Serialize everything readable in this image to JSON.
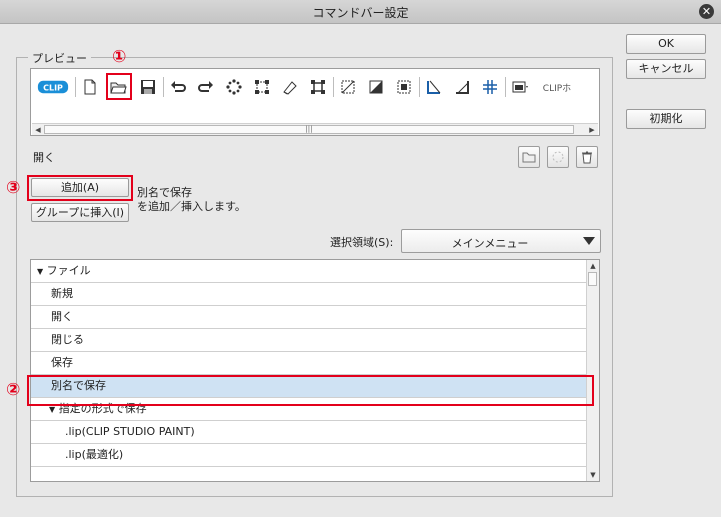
{
  "window": {
    "title": "コマンドバー設定"
  },
  "buttons": {
    "ok": "OK",
    "cancel": "キャンセル",
    "reset": "初期化",
    "add": "追加(A)",
    "insert_group": "グループに挿入(I)"
  },
  "preview": {
    "legend": "プレビュー",
    "toolbar_icons": [
      "clip-logo-icon",
      "new-file-icon",
      "open-folder-icon",
      "save-icon",
      "undo-icon",
      "redo-icon",
      "delete-icon",
      "transform-icon",
      "clear-icon",
      "rotate-icon",
      "select-icon",
      "invert-icon",
      "grid-icon",
      "ruler-icon",
      "snap-icon",
      "layer-icon",
      "dropdown-icon",
      "clip-text-icon"
    ],
    "selected_command": "開く",
    "clip_text": "CLIPホ"
  },
  "description": {
    "line1": "別名で保存",
    "line2": "を追加／挿入します。"
  },
  "select_area": {
    "label": "選択領域(S):",
    "value": "メインメニュー"
  },
  "tree": [
    {
      "label": "ファイル",
      "expandable": true
    },
    {
      "label": "新規"
    },
    {
      "label": "開く"
    },
    {
      "label": "閉じる"
    },
    {
      "label": "保存"
    },
    {
      "label": "別名で保存",
      "selected": true
    },
    {
      "label": "指定の形式で保存",
      "expandable": true
    },
    {
      "label": ".lip(CLIP STUDIO PAINT)"
    },
    {
      "label": ".lip(最適化)"
    }
  ],
  "markers": [
    "①",
    "②",
    "③"
  ],
  "colors": {
    "highlight_red": "#e3001b",
    "selection_blue": "#cfe2f3"
  }
}
